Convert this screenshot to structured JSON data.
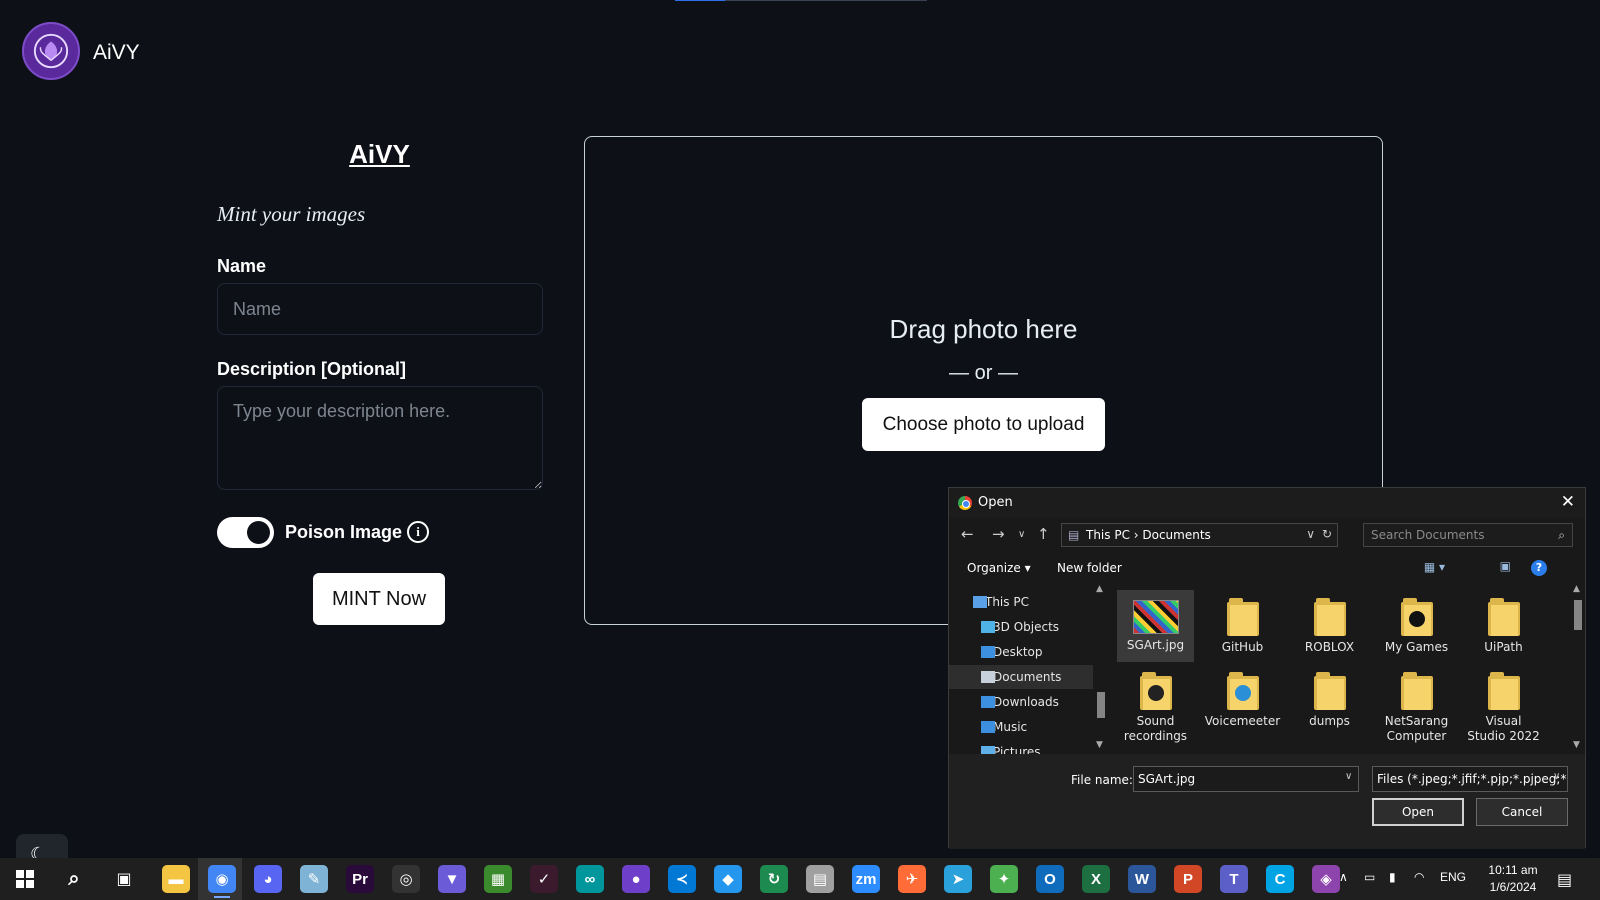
{
  "app": {
    "brand": "AiVY"
  },
  "form": {
    "title": "AiVY",
    "subtitle": "Mint your images",
    "name_label": "Name",
    "name_placeholder": "Name",
    "description_label": "Description [Optional]",
    "description_placeholder": "Type your description here.",
    "poison_label": "Poison Image",
    "poison_enabled": true,
    "info_glyph": "i",
    "mint_button": "MINT Now"
  },
  "upload": {
    "drag_text": "Drag photo here",
    "or_text": "— or —",
    "choose_button": "Choose photo to upload"
  },
  "dialog": {
    "title": "Open",
    "path": [
      "This PC",
      "Documents"
    ],
    "path_text": "This PC  ›  Documents",
    "search_placeholder": "Search Documents",
    "organize": "Organize ▾",
    "new_folder": "New folder",
    "tree": [
      {
        "label": "This PC",
        "icon": "computer-icon",
        "color": "#5aa0e6"
      },
      {
        "label": "3D Objects",
        "icon": "cube-icon",
        "color": "#4fb3e8"
      },
      {
        "label": "Desktop",
        "icon": "desktop-icon",
        "color": "#3d8fe0"
      },
      {
        "label": "Documents",
        "icon": "document-icon",
        "color": "#c8d0dc",
        "selected": true
      },
      {
        "label": "Downloads",
        "icon": "download-icon",
        "color": "#3d8fe0"
      },
      {
        "label": "Music",
        "icon": "music-icon",
        "color": "#3d8fe0"
      },
      {
        "label": "Pictures",
        "icon": "pictures-icon",
        "color": "#5fb0e8"
      }
    ],
    "files": [
      {
        "label": "SGArt.jpg",
        "type": "image",
        "selected": true
      },
      {
        "label": "GitHub",
        "type": "folder"
      },
      {
        "label": "ROBLOX",
        "type": "folder"
      },
      {
        "label": "My Games",
        "type": "folder",
        "badge": "#111111"
      },
      {
        "label": "UiPath",
        "type": "folder"
      },
      {
        "label": "Sound recordings",
        "type": "folder",
        "badge": "#222222"
      },
      {
        "label": "Voicemeeter",
        "type": "folder",
        "badge": "#2a8fd6"
      },
      {
        "label": "dumps",
        "type": "folder"
      },
      {
        "label": "NetSarang Computer",
        "type": "folder"
      },
      {
        "label": "Visual Studio 2022",
        "type": "folder"
      }
    ],
    "file_name_label": "File name:",
    "file_name_value": "SGArt.jpg",
    "file_type_value": "Files (*.jpeg;*.jfif;*.pjp;*.pjpeg;*.jpg)",
    "open_button": "Open",
    "cancel_button": "Cancel"
  },
  "taskbar": {
    "apps": [
      {
        "name": "file-explorer-icon",
        "color": "#f4c542",
        "glyph": "▬"
      },
      {
        "name": "chrome-icon",
        "color": "#4285f4",
        "glyph": "◉",
        "active": true
      },
      {
        "name": "discord-icon",
        "color": "#5865f2",
        "glyph": "◕"
      },
      {
        "name": "paint-icon",
        "color": "#7fb3d5",
        "glyph": "✎"
      },
      {
        "name": "premiere-icon",
        "color": "#2a0a3a",
        "glyph": "Pr"
      },
      {
        "name": "obs-icon",
        "color": "#333333",
        "glyph": "◎"
      },
      {
        "name": "vpn-icon",
        "color": "#6b5bd6",
        "glyph": "▼"
      },
      {
        "name": "minecraft-icon",
        "color": "#3c8a2e",
        "glyph": "▦"
      },
      {
        "name": "vectornator-icon",
        "color": "#3b1a2e",
        "glyph": "✓"
      },
      {
        "name": "arduino-icon",
        "color": "#00979c",
        "glyph": "∞"
      },
      {
        "name": "github-icon",
        "color": "#6e40c9",
        "glyph": "●"
      },
      {
        "name": "vscode-icon",
        "color": "#0078d4",
        "glyph": "≺"
      },
      {
        "name": "docker-icon",
        "color": "#2496ed",
        "glyph": "◆"
      },
      {
        "name": "refresh-app-icon",
        "color": "#1d8a4f",
        "glyph": "↻"
      },
      {
        "name": "folder-app-icon",
        "color": "#a0a0a0",
        "glyph": "▤"
      },
      {
        "name": "zoom-icon",
        "color": "#2d8cff",
        "glyph": "zm"
      },
      {
        "name": "postman-icon",
        "color": "#ff6c37",
        "glyph": "✈"
      },
      {
        "name": "telegram-icon",
        "color": "#2aa1da",
        "glyph": "➤"
      },
      {
        "name": "bittorrent-icon",
        "color": "#4caf50",
        "glyph": "✦"
      },
      {
        "name": "outlook-icon",
        "color": "#0f6cbd",
        "glyph": "O"
      },
      {
        "name": "excel-icon",
        "color": "#1d6f42",
        "glyph": "X"
      },
      {
        "name": "word-icon",
        "color": "#2b579a",
        "glyph": "W"
      },
      {
        "name": "powerpoint-icon",
        "color": "#d24726",
        "glyph": "P"
      },
      {
        "name": "teams-icon",
        "color": "#5b5fc7",
        "glyph": "T"
      },
      {
        "name": "ccleaner-icon",
        "color": "#00a4e4",
        "glyph": "C"
      },
      {
        "name": "git-icon",
        "color": "#8e44ad",
        "glyph": "◈"
      }
    ],
    "language": "ENG",
    "time": "10:11 am",
    "date": "1/6/2024"
  }
}
